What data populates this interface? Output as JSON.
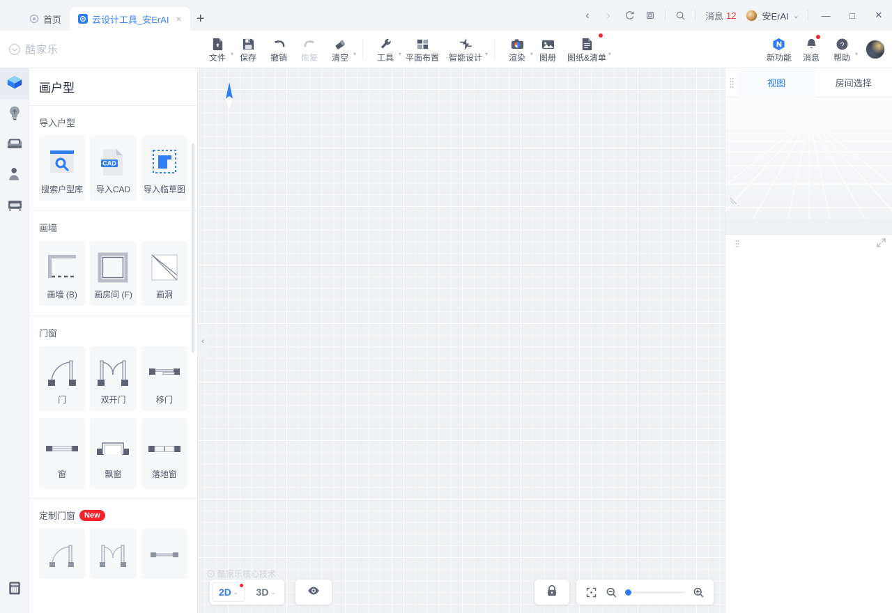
{
  "titlebar": {
    "tabs": [
      {
        "label": "首页",
        "icon": "home-circle-icon",
        "active": false
      },
      {
        "label": "云设计工具_安ErAI",
        "icon": "app-logo-icon",
        "active": true,
        "close": "×"
      }
    ],
    "new_tab": "+",
    "nav": {
      "back": "‹",
      "forward": "›",
      "refresh": "refresh-icon",
      "copy": "copy-icon",
      "search": "search-icon"
    },
    "message": {
      "label": "消息",
      "count": "12"
    },
    "user": {
      "name": "安ErAI",
      "chevron": "⌄"
    },
    "window": {
      "minimize": "—",
      "maximize": "□",
      "close": "✕"
    }
  },
  "toolbar": {
    "brand": "酷家乐",
    "groups": [
      {
        "items": [
          {
            "label": "文件",
            "icon": "file-icon",
            "caret": true
          },
          {
            "label": "保存",
            "icon": "save-icon",
            "caret": false
          },
          {
            "label": "撤销",
            "icon": "undo-icon",
            "caret": false
          },
          {
            "label": "恢复",
            "icon": "redo-icon",
            "caret": false,
            "disabled": true
          },
          {
            "label": "清空",
            "icon": "eraser-icon",
            "caret": true
          }
        ]
      },
      {
        "items": [
          {
            "label": "工具",
            "icon": "wrench-icon",
            "caret": true
          },
          {
            "label": "平面布置",
            "icon": "floorplan-icon",
            "caret": false
          },
          {
            "label": "智能设计",
            "icon": "ai-design-icon",
            "caret": true
          }
        ]
      },
      {
        "items": [
          {
            "label": "渲染",
            "icon": "camera-icon",
            "caret": true
          },
          {
            "label": "图册",
            "icon": "album-icon",
            "caret": false
          },
          {
            "label": "图纸&清单",
            "icon": "drawings-list-icon",
            "caret": true,
            "dot": true
          }
        ]
      }
    ],
    "right": [
      {
        "label": "新功能",
        "icon": "new-feature-icon",
        "caret": false
      },
      {
        "label": "消息",
        "icon": "bell-icon",
        "caret": false,
        "dot": true
      },
      {
        "label": "帮助",
        "icon": "help-icon",
        "caret": true
      }
    ],
    "avatar": "user-avatar"
  },
  "rail": {
    "items": [
      {
        "name": "floorplan",
        "icon": "cube-icon",
        "active": true
      },
      {
        "name": "lighting",
        "icon": "bulb-icon",
        "active": false
      },
      {
        "name": "furniture",
        "icon": "sofa-icon",
        "active": false
      },
      {
        "name": "people",
        "icon": "person-icon",
        "active": false
      },
      {
        "name": "appliance",
        "icon": "cabinet-icon",
        "active": false
      }
    ],
    "bottom": {
      "name": "materials",
      "icon": "washer-icon"
    }
  },
  "left_panel": {
    "title": "画户型",
    "collapse": "‹",
    "sections": [
      {
        "title": "导入户型",
        "badge": null,
        "items": [
          {
            "label": "搜索户型库",
            "icon": "search-plan-icon"
          },
          {
            "label": "导入CAD",
            "icon": "cad-file-icon"
          },
          {
            "label": "导入临草图",
            "icon": "sketch-import-icon"
          }
        ]
      },
      {
        "title": "画墙",
        "badge": null,
        "items": [
          {
            "label": "画墙 (B)",
            "icon": "draw-wall-icon"
          },
          {
            "label": "画房间 (F)",
            "icon": "draw-room-icon"
          },
          {
            "label": "画洞",
            "icon": "draw-hole-icon"
          }
        ]
      },
      {
        "title": "门窗",
        "badge": null,
        "items": [
          {
            "label": "门",
            "icon": "door-icon"
          },
          {
            "label": "双开门",
            "icon": "double-door-icon"
          },
          {
            "label": "移门",
            "icon": "sliding-door-icon"
          }
        ]
      },
      {
        "title": null,
        "badge": null,
        "items": [
          {
            "label": "窗",
            "icon": "window-icon"
          },
          {
            "label": "飘窗",
            "icon": "bay-window-icon"
          },
          {
            "label": "落地窗",
            "icon": "french-window-icon"
          }
        ]
      },
      {
        "title": "定制门窗",
        "badge": "New",
        "items": [
          {
            "label": "",
            "icon": "custom-door-icon"
          },
          {
            "label": "",
            "icon": "custom-double-door-icon"
          },
          {
            "label": "",
            "icon": "custom-sliding-door-icon"
          }
        ]
      }
    ]
  },
  "canvas": {
    "compass": "north-arrow-icon",
    "watermark": "酷家乐核心技术",
    "bottom": {
      "mode_2d": "2D",
      "mode_3d": "3D",
      "caret": "⌄",
      "eye": "eye-icon",
      "lock": "lock-icon",
      "fit": "fit-to-screen-icon",
      "zoom_out": "zoom-out-icon",
      "zoom_in": "zoom-in-icon",
      "zoom_value": "0"
    }
  },
  "right_panel": {
    "grip": "drag-grip-icon",
    "tabs": [
      {
        "label": "视图",
        "active": true
      },
      {
        "label": "房间选择",
        "active": false
      }
    ],
    "axis": "axis-gizmo-icon",
    "expand": "expand-icon",
    "lower_grip": "drag-grip-icon"
  },
  "colors": {
    "accent": "#2f7ef5",
    "danger": "#f5222d",
    "text": "#4d5465",
    "panel_bg": "#ffffff",
    "canvas_bg": "#eff0f2"
  }
}
